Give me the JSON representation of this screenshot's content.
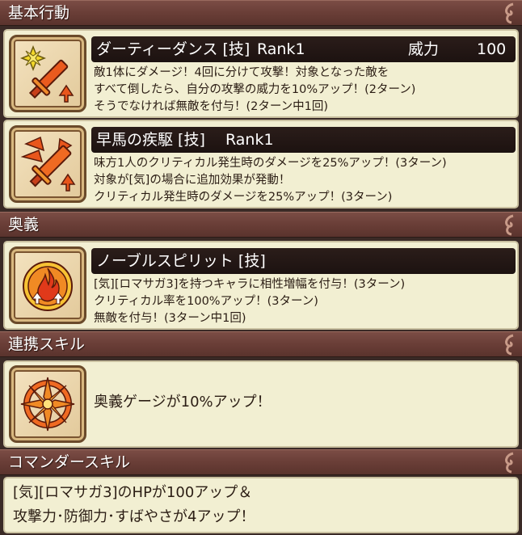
{
  "sections": {
    "basic": "基本行動",
    "ougi": "奥義",
    "renkei": "連携スキル",
    "commander": "コマンダースキル"
  },
  "skills": [
    {
      "name": "ダーティーダンス [技]",
      "rank": "Rank1",
      "power_label": "威力",
      "power_value": "100",
      "lines": [
        "敵1体にダメージ！4回に分けて攻撃！対象となった敵を",
        "すべて倒したら、自分の攻撃の威力を10%アップ！(2ターン)",
        "そうでなければ無敵を付与！(2ターン中1回)"
      ],
      "icon": "sword-burst-icon"
    },
    {
      "name": "早馬の疾駆 [技]",
      "rank": "Rank1",
      "lines": [
        "味方1人のクリティカル発生時のダメージを25%アップ！(3ターン)",
        "対象が[気]の場合に追加効果が発動！",
        "クリティカル発生時のダメージを25%アップ！(3ターン)"
      ],
      "icon": "swift-blade-icon"
    }
  ],
  "ougi": {
    "name": "ノーブルスピリット [技]",
    "lines": [
      "[気][ロマサガ3]を持つキャラに相性増幅を付与！(3ターン)",
      "クリティカル率を100%アップ！(3ターン)",
      "無敵を付与！(3ターン中1回)"
    ],
    "icon": "flame-emblem-icon"
  },
  "renkei": {
    "text": "奥義ゲージが10%アップ！",
    "icon": "compass-star-icon"
  },
  "commander": {
    "lines": [
      "[気][ロマサガ3]のHPが100アップ＆",
      "攻撃力･防御力･すばやさが4アップ！"
    ]
  },
  "colors": {
    "header": "#6b3f38",
    "panel": "#f2efd2",
    "bar": "#231714",
    "icon_fire": "#e8561c"
  }
}
